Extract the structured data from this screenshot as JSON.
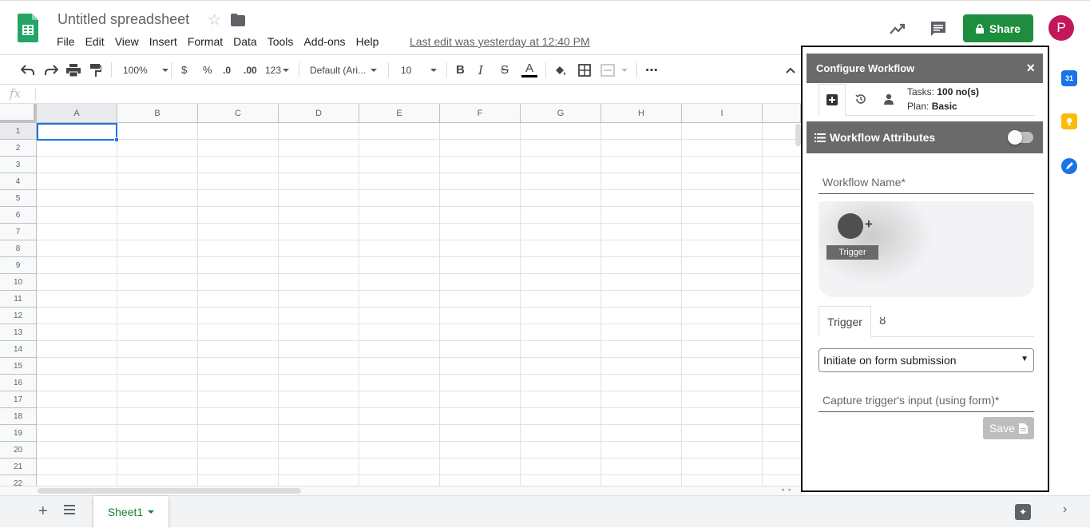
{
  "header": {
    "title": "Untitled spreadsheet",
    "menu": [
      "File",
      "Edit",
      "View",
      "Insert",
      "Format",
      "Data",
      "Tools",
      "Add-ons",
      "Help"
    ],
    "last_edit": "Last edit was yesterday at 12:40 PM",
    "share_label": "Share",
    "avatar_letter": "P"
  },
  "toolbar": {
    "zoom": "100%",
    "currency": "$",
    "percent": "%",
    "decrease_decimal": ".0",
    "increase_decimal": ".00",
    "more_formats": "123",
    "font": "Default (Ari...",
    "font_size": "10",
    "bold": "B",
    "italic": "I",
    "strikethrough": "S",
    "text_color": "A",
    "more": "⋯"
  },
  "formula_bar": {
    "fx": "fx"
  },
  "grid": {
    "columns": [
      "A",
      "B",
      "C",
      "D",
      "E",
      "F",
      "G",
      "H",
      "I"
    ],
    "rows": [
      "1",
      "2",
      "3",
      "4",
      "5",
      "6",
      "7",
      "8",
      "9",
      "10",
      "11",
      "12",
      "13",
      "14",
      "15",
      "16",
      "17",
      "18",
      "19",
      "20",
      "21",
      "22"
    ],
    "selected_cell": "A1"
  },
  "sheets": {
    "active_tab": "Sheet1"
  },
  "side_rail": {
    "calendar_day": "31"
  },
  "workflow_panel": {
    "title": "Configure Workflow",
    "close": "×",
    "tasks_label": "Tasks:",
    "tasks_value": "100 no(s)",
    "plan_label": "Plan:",
    "plan_value": "Basic",
    "attributes_label": "Workflow Attributes",
    "attributes_toggle_on": false,
    "workflow_name_placeholder": "Workflow Name*",
    "trigger_node_label": "Trigger",
    "add_node": "+",
    "tab_trigger": "Trigger",
    "tab_branch": "ȣ",
    "trigger_option": "Initiate on form submission",
    "capture_placeholder": "Capture trigger's input (using form)*",
    "save_label": "Save"
  },
  "colors": {
    "share_green": "#1e8e3e",
    "avatar": "#c2185b",
    "panel_header": "#6a6a6a",
    "selection_blue": "#1a73e8",
    "sheet_tab_green": "#188038"
  }
}
